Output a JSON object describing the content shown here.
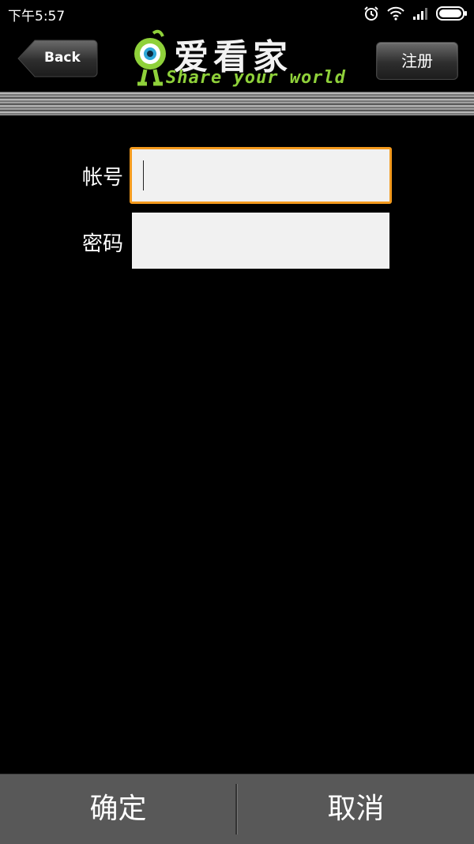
{
  "status_bar": {
    "time": "下午5:57",
    "icons": [
      "alarm-icon",
      "wifi-icon",
      "signal-icon",
      "battery-icon"
    ]
  },
  "header": {
    "back_label": "Back",
    "logo_title": "爱看家",
    "logo_tagline": "Share your world",
    "register_label": "注册"
  },
  "form": {
    "account_label": "帐号",
    "account_value": "",
    "password_label": "密码",
    "password_value": ""
  },
  "footer": {
    "confirm_label": "确定",
    "cancel_label": "取消"
  },
  "colors": {
    "background": "#000000",
    "focus_border": "#f39a1e",
    "tagline": "#8fd13a",
    "bottom_bar": "#585858"
  }
}
